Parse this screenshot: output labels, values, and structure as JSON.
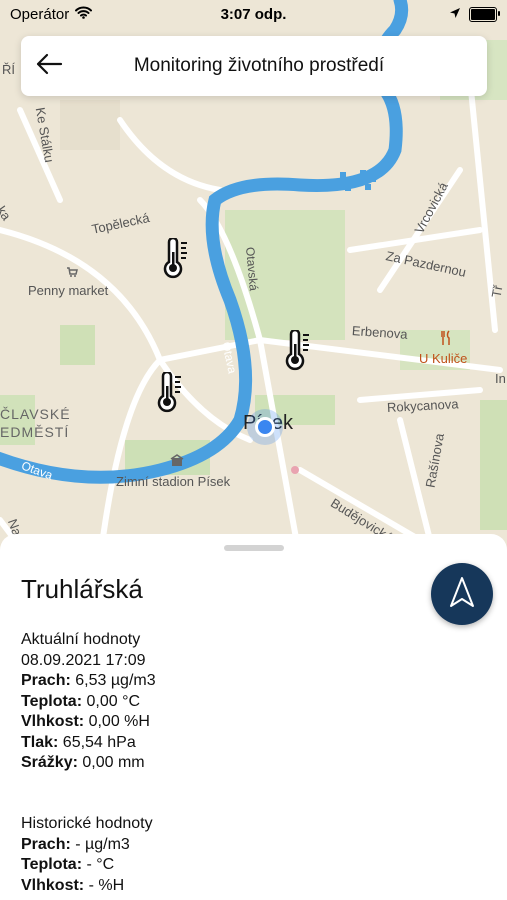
{
  "status_bar": {
    "carrier": "Operátor",
    "time": "3:07 odp.",
    "battery_level": 1.0
  },
  "header": {
    "title": "Monitoring životního prostředí",
    "back_icon": "arrow-left-icon"
  },
  "map": {
    "labels": {
      "tr": "ŘÍ",
      "ke_stalku": "Ke Stálku",
      "topelecka": "Topělecká",
      "vrcovicka": "Vrcovická",
      "za_pazdernou": "Za Pazdernou",
      "penny_market": "Penny market",
      "otavska": "Otavská",
      "erbenova": "Erbenova",
      "u_kulice": "U Kuliče",
      "in": "In",
      "tr2": "Tř",
      "clavske": "ČLAVSKÉ",
      "edmesti": "EDMĚSTÍ",
      "otava1": "Otava",
      "otava2": "Otava",
      "pisek": "Písek",
      "rokycanova": "Rokycanova",
      "rasinova": "Rašínova",
      "zimni_stadion": "Zimní stadion Písek",
      "budejovicka": "Budějovická",
      "na": "Na",
      "kla": "ka"
    },
    "accent_river": "#4aa0e0",
    "accent_poi": "#c0521a",
    "user_location_color": "#3a86f0",
    "markers": [
      "thermometer-icon",
      "thermometer-icon",
      "thermometer-icon"
    ]
  },
  "sheet": {
    "title": "Truhlářská",
    "nav_icon": "navigation-arrow-icon",
    "current": {
      "heading": "Aktuální hodnoty",
      "datetime": "08.09.2021 17:09",
      "rows": [
        {
          "label": "Prach:",
          "value": " 6,53 µg/m3"
        },
        {
          "label": "Teplota:",
          "value": " 0,00 °C"
        },
        {
          "label": "Vlhkost:",
          "value": " 0,00 %H"
        },
        {
          "label": "Tlak:",
          "value": " 65,54 hPa"
        },
        {
          "label": "Srážky:",
          "value": " 0,00 mm"
        }
      ]
    },
    "historic": {
      "heading": "Historické hodnoty",
      "rows": [
        {
          "label": "Prach:",
          "value": " - µg/m3"
        },
        {
          "label": "Teplota:",
          "value": " - °C"
        },
        {
          "label": "Vlhkost:",
          "value": " - %H"
        }
      ]
    }
  }
}
